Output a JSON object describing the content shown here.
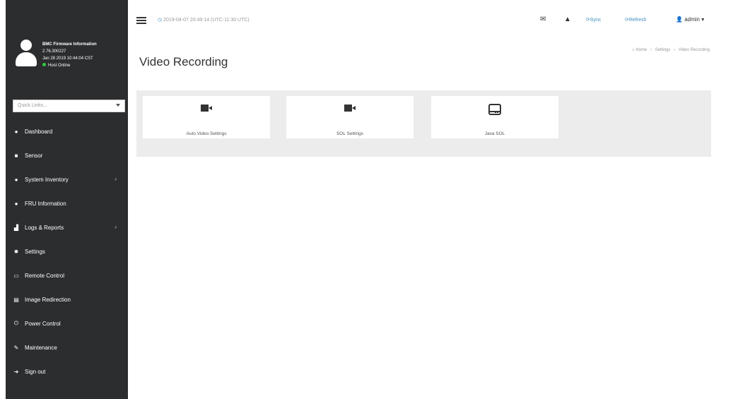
{
  "sidebar": {
    "user": {
      "fw_title": "BMC Firmware Information",
      "fw_version": "2.76.300227",
      "fw_date": "Jan 28 2019 10:44:04 CST",
      "status": "Host Online"
    },
    "quick_links_placeholder": "Quick Links...",
    "items": [
      {
        "label": "Dashboard",
        "icon": "dashboard-icon"
      },
      {
        "label": "Sensor",
        "icon": "sensor-icon"
      },
      {
        "label": "System Inventory",
        "icon": "info-icon"
      },
      {
        "label": "FRU Information",
        "icon": "info-icon"
      },
      {
        "label": "Logs & Reports",
        "icon": "chart-icon"
      },
      {
        "label": "Settings",
        "icon": "gear-icon"
      },
      {
        "label": "Remote Control",
        "icon": "monitor-icon"
      },
      {
        "label": "Image Redirection",
        "icon": "disk-icon"
      },
      {
        "label": "Power Control",
        "icon": "power-icon"
      },
      {
        "label": "Maintenance",
        "icon": "wrench-icon"
      },
      {
        "label": "Sign out",
        "icon": "sign-out-icon"
      }
    ]
  },
  "topbar": {
    "datetime": "2019-04-07 20:49:14 (UTC-11:30 UTC)",
    "sync": "Sync",
    "refresh": "Refresh",
    "user": "admin"
  },
  "page": {
    "title": "Video Recording",
    "breadcrumb": [
      "Home",
      "Settings",
      "Video Recording"
    ]
  },
  "tiles": [
    {
      "label": "Auto Video Settings",
      "icon": "video-camera-icon"
    },
    {
      "label": "SOL Settings",
      "icon": "video-camera-icon"
    },
    {
      "label": "Java SOL",
      "icon": "hard-drive-icon"
    }
  ]
}
